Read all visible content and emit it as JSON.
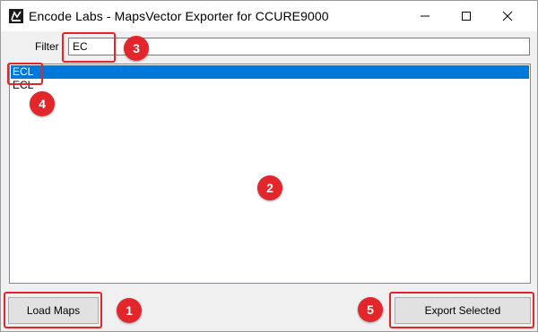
{
  "window": {
    "title": "Encode Labs - MapsVector Exporter for CCURE9000",
    "app_icon": "app-icon",
    "controls": {
      "minimize": "minimize-icon",
      "maximize": "maximize-icon",
      "close": "close-icon"
    }
  },
  "filter": {
    "label": "Filter",
    "value": "EC"
  },
  "list": {
    "items": [
      {
        "label": "ECL",
        "selected": true
      },
      {
        "label": "ECL",
        "selected": false
      }
    ]
  },
  "buttons": {
    "load_maps": "Load Maps",
    "export_selected": "Export Selected"
  },
  "annotations": {
    "marker_1": "1",
    "marker_2": "2",
    "marker_3": "3",
    "marker_4": "4",
    "marker_5": "5",
    "color": "#e3262b"
  },
  "colors": {
    "selection": "#0078d7",
    "titlebar": "#ffffff",
    "window_bg": "#f0f0f0"
  }
}
